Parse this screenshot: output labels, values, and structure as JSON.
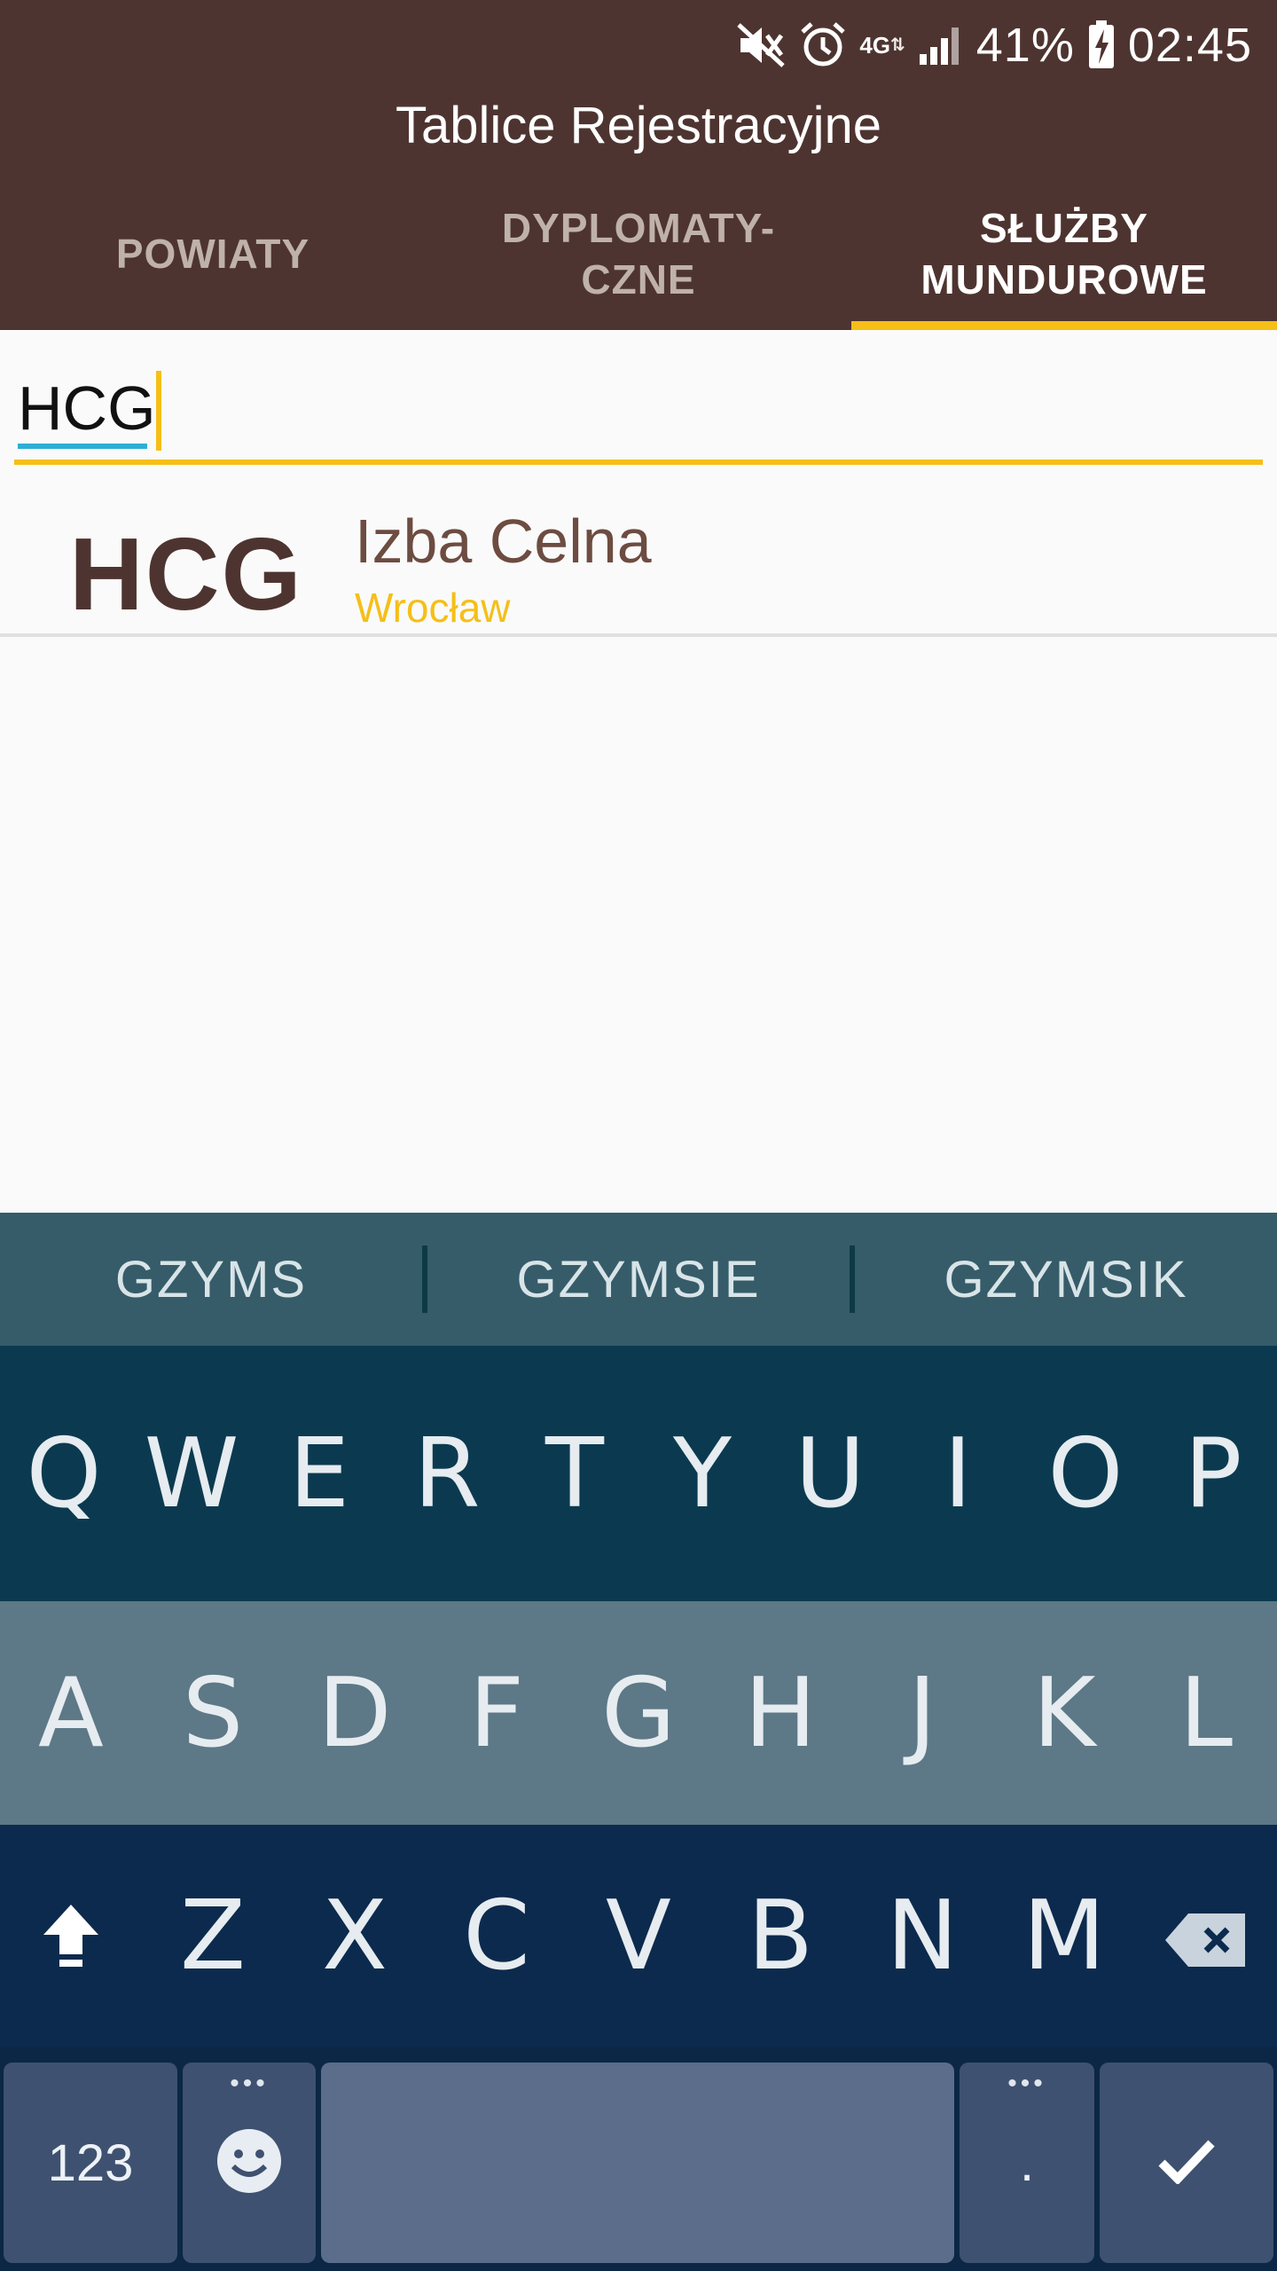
{
  "status_bar": {
    "network": "4G",
    "battery_percent": "41%",
    "time": "02:45",
    "icons": [
      "mute-icon",
      "alarm-icon",
      "network-4g-icon",
      "signal-icon",
      "battery-charging-icon"
    ]
  },
  "app": {
    "title": "Tablice Rejestracyjne"
  },
  "tabs": [
    {
      "label": "POWIATY",
      "active": false
    },
    {
      "label": "DYPLOMATY-\nCZNE",
      "active": false
    },
    {
      "label": "SŁUŻBY\nMUNDUROWE",
      "active": true
    }
  ],
  "search": {
    "value": "HCG"
  },
  "results": [
    {
      "code": "HCG",
      "name": "Izba Celna",
      "city": "Wrocław"
    }
  ],
  "keyboard": {
    "suggestions": [
      "GZYMS",
      "GZYMSIE",
      "GZYMSIK"
    ],
    "row1": [
      "Q",
      "W",
      "E",
      "R",
      "T",
      "Y",
      "U",
      "I",
      "O",
      "P"
    ],
    "row2": [
      "A",
      "S",
      "D",
      "F",
      "G",
      "H",
      "J",
      "K",
      "L"
    ],
    "row3": [
      "Z",
      "X",
      "C",
      "V",
      "B",
      "N",
      "M"
    ],
    "numbers_label": "123",
    "period_label": ".",
    "more_dots": "•••",
    "icons": [
      "shift-icon",
      "backspace-icon",
      "emoji-icon",
      "enter-check-icon"
    ]
  },
  "colors": {
    "appbar": "#4e3430",
    "accent": "#f5bf18",
    "composing": "#2eaed6",
    "result_name": "#6d4c41"
  }
}
